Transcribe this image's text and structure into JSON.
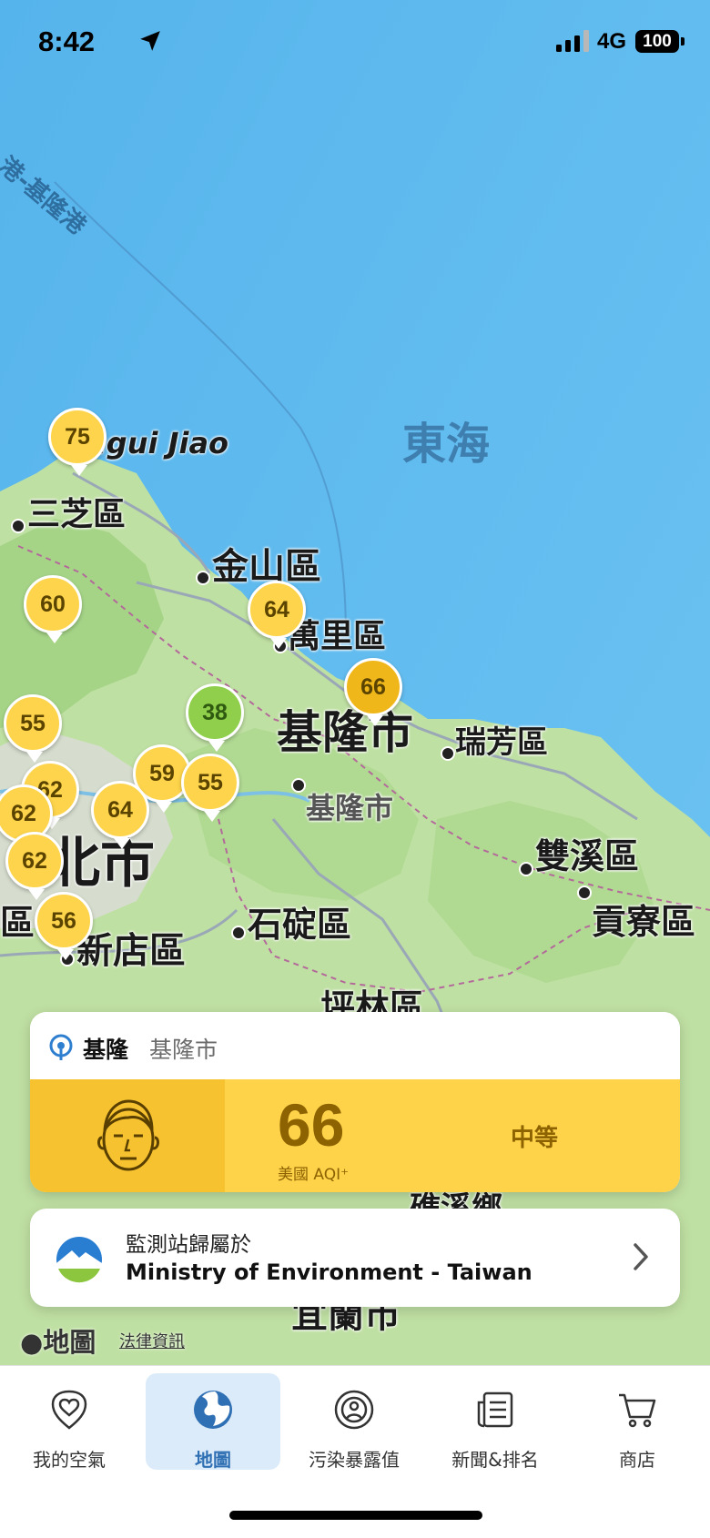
{
  "status_bar": {
    "time": "8:42",
    "network": "4G",
    "battery": "100"
  },
  "map": {
    "sea_labels": {
      "east_sea": "東海",
      "port_route": "港-基隆港",
      "cape": "ugui Jiao"
    },
    "places": {
      "sanzhi": "三芝區",
      "jinshan": "金山區",
      "wanli": "萬里區",
      "keelung_big": "基隆市",
      "ruifang": "瑞芳區",
      "keelung_small": "基隆市",
      "shuangxi": "雙溪區",
      "gongliao": "貢寮區",
      "shiding": "石碇區",
      "xindian": "新店區",
      "pinglin": "坪林區",
      "taipei_big": "北市",
      "district_edge": "區",
      "jiaoxi": "礁溪鄉",
      "yilan": "宜蘭市"
    },
    "pins": [
      {
        "value": "75",
        "color": "#fdd44b"
      },
      {
        "value": "60",
        "color": "#fdd44b"
      },
      {
        "value": "64",
        "color": "#fdd44b"
      },
      {
        "value": "66",
        "color": "#f0b71b"
      },
      {
        "value": "38",
        "color": "#8fcf4c"
      },
      {
        "value": "55",
        "color": "#fdd44b"
      },
      {
        "value": "59",
        "color": "#fdd44b"
      },
      {
        "value": "55",
        "color": "#fdd44b"
      },
      {
        "value": "62",
        "color": "#fdd44b"
      },
      {
        "value": "62",
        "color": "#fdd44b"
      },
      {
        "value": "64",
        "color": "#fdd44b"
      },
      {
        "value": "62",
        "color": "#fdd44b"
      },
      {
        "value": "56",
        "color": "#fdd44b"
      }
    ],
    "apple_maps": "地圖",
    "legal": "法律資訊"
  },
  "station_card": {
    "station": "基隆",
    "city": "基隆市",
    "aqi": "66",
    "aqi_label": "美國 AQI⁺",
    "level": "中等"
  },
  "source_card": {
    "label": "監測站歸屬於",
    "org": "Ministry of Environment - Taiwan"
  },
  "tabs": [
    {
      "label": "我的空氣",
      "icon": "heart-pin-icon"
    },
    {
      "label": "地圖",
      "icon": "globe-icon"
    },
    {
      "label": "污染暴露值",
      "icon": "exposure-icon"
    },
    {
      "label": "新聞&排名",
      "icon": "news-icon"
    },
    {
      "label": "商店",
      "icon": "cart-icon"
    }
  ]
}
